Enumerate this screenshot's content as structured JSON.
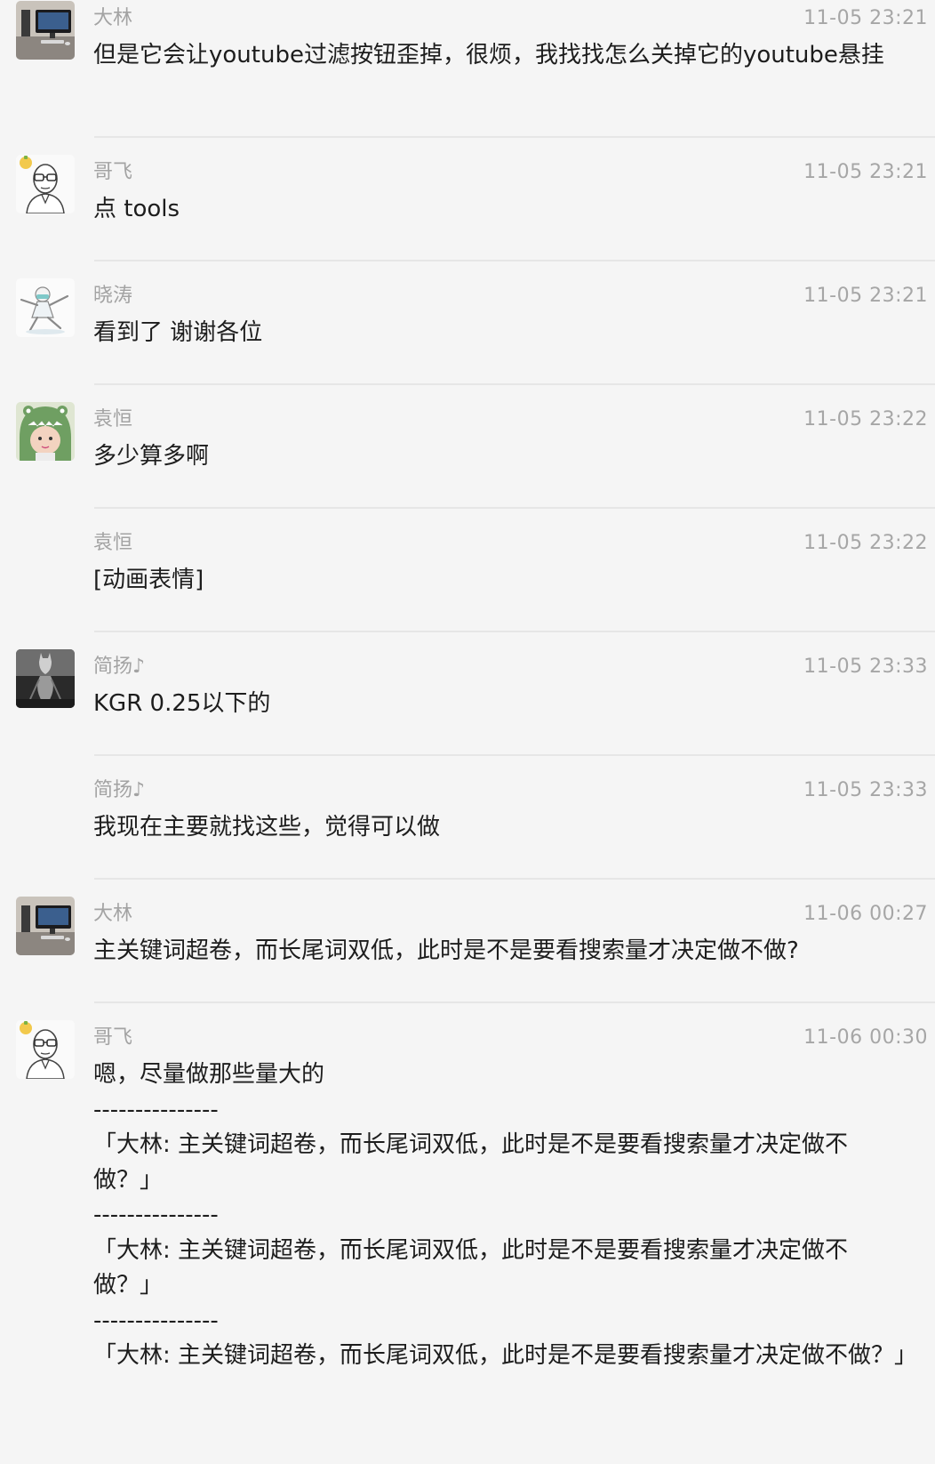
{
  "messages": [
    {
      "sender": "大林",
      "time": "11-05 23:21",
      "text": "但是它会让youtube过滤按钮歪掉，很烦，我找找怎么关掉它的youtube悬挂",
      "avatar": "desk-photo-avatar",
      "show_avatar": true
    },
    {
      "sender": "哥飞",
      "time": "11-05 23:21",
      "text": "点 tools",
      "avatar": "glasses-man-avatar",
      "show_avatar": true
    },
    {
      "sender": "晓涛",
      "time": "11-05 23:21",
      "text": "看到了 谢谢各位",
      "avatar": "dancing-figure-avatar",
      "show_avatar": true
    },
    {
      "sender": "袁恒",
      "time": "11-05 23:22",
      "text": "多少算多啊",
      "avatar": "dino-hat-baby-avatar",
      "show_avatar": true
    },
    {
      "sender": "袁恒",
      "time": "11-05 23:22",
      "text": "[动画表情]",
      "avatar": "",
      "show_avatar": false
    },
    {
      "sender": "简扬♪",
      "time": "11-05 23:33",
      "text": "KGR 0.25以下的",
      "avatar": "cat-reflection-avatar",
      "show_avatar": true
    },
    {
      "sender": "简扬♪",
      "time": "11-05 23:33",
      "text": "我现在主要就找这些，觉得可以做",
      "avatar": "",
      "show_avatar": false
    },
    {
      "sender": "大林",
      "time": "11-06 00:27",
      "text": "主关键词超卷，而长尾词双低，此时是不是要看搜索量才决定做不做?",
      "avatar": "desk-photo-avatar",
      "show_avatar": true
    },
    {
      "sender": "哥飞",
      "time": "11-06 00:30",
      "text": "嗯，尽量做那些量大的\n---------------\n「大林: 主关键词超卷，而长尾词双低，此时是不是要看搜索量才决定做不做？」\n---------------\n「大林: 主关键词超卷，而长尾词双低，此时是不是要看搜索量才决定做不做？」\n---------------\n「大林: 主关键词超卷，而长尾词双低，此时是不是要看搜索量才决定做不做？」",
      "avatar": "glasses-man-avatar",
      "show_avatar": true
    }
  ]
}
